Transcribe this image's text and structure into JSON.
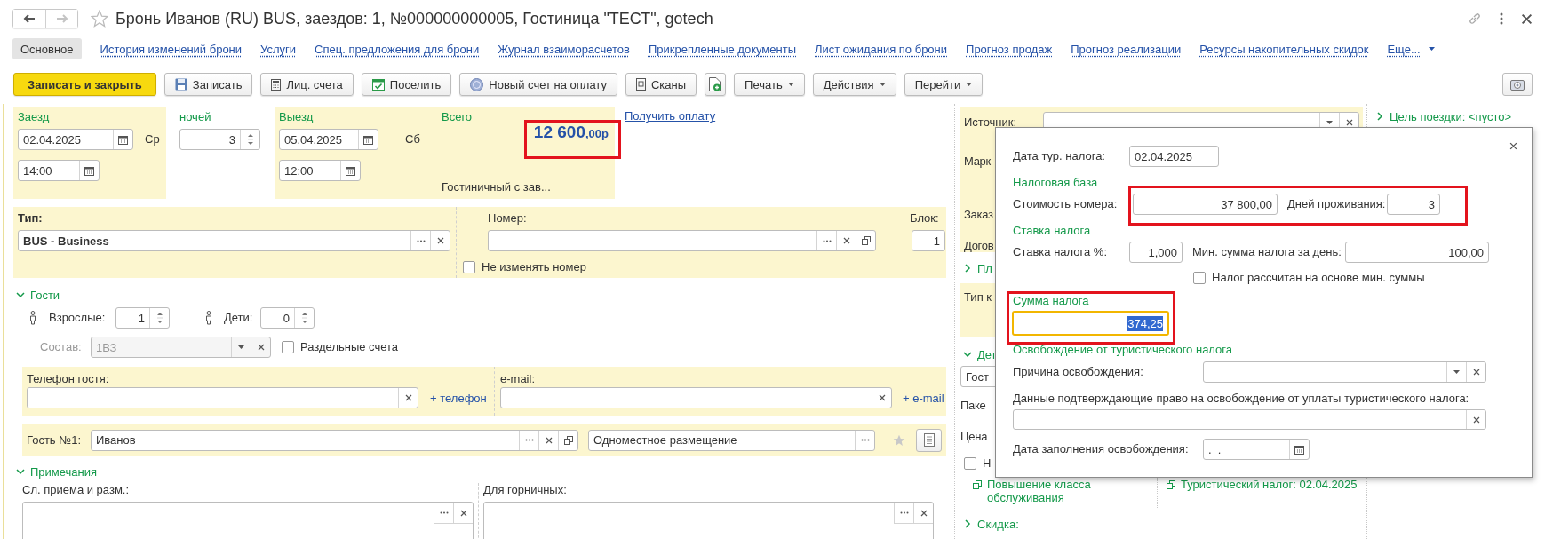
{
  "window": {
    "title": "Бронь Иванов (RU) BUS, заездов: 1, №000000000005, Гостиница \"ТЕСТ\", gotech"
  },
  "tabs": [
    {
      "label": "Основное",
      "selected": true
    },
    {
      "label": "История изменений брони",
      "selected": false
    },
    {
      "label": "Услуги",
      "selected": false
    },
    {
      "label": "Спец. предложения для брони",
      "selected": false
    },
    {
      "label": "Журнал взаиморасчетов",
      "selected": false
    },
    {
      "label": "Прикрепленные документы",
      "selected": false
    },
    {
      "label": "Лист ожидания по брони",
      "selected": false
    },
    {
      "label": "Прогноз продаж",
      "selected": false
    },
    {
      "label": "Прогноз реализации",
      "selected": false
    },
    {
      "label": "Ресурсы накопительных скидок",
      "selected": false
    }
  ],
  "more_menu": "Еще...",
  "toolbar": [
    {
      "label": "Записать и закрыть",
      "kind": "primary"
    },
    {
      "label": "Записать",
      "kind": "icon_text"
    },
    {
      "label": "Лиц. счета",
      "kind": "icon_text"
    },
    {
      "label": "Поселить",
      "kind": "icon_text"
    },
    {
      "label": "Новый счет на оплату",
      "kind": "icon_text"
    },
    {
      "label": "Сканы",
      "kind": "icon_text"
    },
    {
      "kind": "icon"
    },
    {
      "label": "Печать",
      "kind": "menu"
    },
    {
      "label": "Действия",
      "kind": "menu"
    },
    {
      "label": "Перейти",
      "kind": "menu"
    }
  ],
  "stay": {
    "checkin": {
      "label": "Заезд",
      "date": "02.04.2025",
      "weekday": "Ср",
      "time": "14:00"
    },
    "nights": {
      "label": "ночей",
      "value": "3"
    },
    "checkout": {
      "label": "Выезд",
      "date": "05.04.2025",
      "weekday": "Сб",
      "time": "12:00"
    },
    "total": {
      "label": "Всего",
      "amount": "12 600",
      "fraction": ",00р",
      "note": "Гостиничный с зав...",
      "highlighted": true
    },
    "payment_link": "Получить оплату"
  },
  "room": {
    "type": {
      "label": "Тип:",
      "value": "BUS - Business"
    },
    "number": {
      "label": "Номер:"
    },
    "block": {
      "label": "Блок:",
      "value": "1"
    },
    "keep_number": {
      "label": "Не изменять номер",
      "checked": false
    }
  },
  "guests": {
    "title": "Гости",
    "expanded": true,
    "adults": {
      "label": "Взрослые:",
      "value": "1"
    },
    "children": {
      "label": "Дети:",
      "value": "0"
    },
    "composition": {
      "label": "Состав:",
      "value": "1ВЗ",
      "disabled": true
    },
    "separate_accounts": {
      "label": "Раздельные счета",
      "checked": false
    },
    "phone": {
      "label": "Телефон гостя:",
      "add": "+ телефон"
    },
    "email": {
      "label": "e-mail:",
      "add": "+ e-mail"
    },
    "guest": {
      "label": "Гость №1:",
      "name": "Иванов",
      "placement": "Одноместное размещение"
    }
  },
  "notes": {
    "title": "Примечания",
    "expanded": true,
    "reception": {
      "label": "Сл. приема и разм.:"
    },
    "maids": {
      "label": "Для горничных:"
    }
  },
  "side": {
    "source": {
      "label": "Источник:"
    },
    "fragments": [
      {
        "text": "Марк"
      },
      {
        "text": "Заказ"
      },
      {
        "text": "Догов"
      }
    ],
    "plan": {
      "title": "Пл",
      "expanded": false
    },
    "client_type": {
      "label": "Тип к"
    },
    "details": {
      "title": "Дет",
      "expanded": true,
      "field_value": "Гост",
      "fragments": [
        {
          "text": "Паке"
        },
        {
          "text": "Цена"
        }
      ],
      "checkbox": {
        "label": "Н",
        "checked": false
      }
    },
    "links": [
      {
        "text": "Повышение класса обслуживания"
      },
      {
        "text": "Туристический налог: 02.04.2025"
      }
    ],
    "discount": {
      "title": "Скидка:",
      "expanded": false
    }
  },
  "trip_purpose": {
    "title": "Цель поездки: <пусто>",
    "expanded": false
  },
  "popup": {
    "tax_date": {
      "label": "Дата тур. налога:",
      "value": "02.04.2025"
    },
    "base": {
      "title": "Налоговая база",
      "highlighted": true,
      "room_cost": {
        "label": "Стоимость номера:",
        "value": "37 800,00"
      },
      "days": {
        "label": "Дней проживания:",
        "value": "3"
      }
    },
    "rate": {
      "title": "Ставка налога",
      "percent": {
        "label": "Ставка налога %:",
        "value": "1,000"
      },
      "min_sum": {
        "label": "Мин. сумма налога за день:",
        "value": "100,00"
      },
      "by_min": {
        "label": "Налог рассчитан на основе мин. суммы",
        "checked": false
      }
    },
    "sum": {
      "label": "Сумма налога",
      "value": "374,25",
      "highlighted": true,
      "focused": true,
      "text_selected": true
    },
    "exemption": {
      "title": "Освобождение от туристического налога",
      "reason": {
        "label": "Причина освобождения:"
      },
      "proof": {
        "label": "Данные подтверждающие право на освобождение от уплаты туристического налога:"
      },
      "date": {
        "label": "Дата заполнения освобождения:",
        "value": ".  ."
      }
    }
  }
}
